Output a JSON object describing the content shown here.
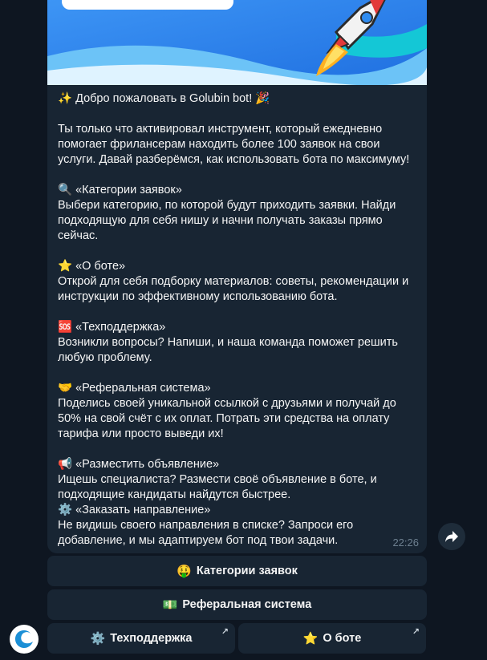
{
  "message": {
    "lines": [
      "✨ Добро пожаловать в Golubin bot! 🎉",
      "",
      "Ты только что активировал инструмент, который ежедневно",
      "помогает фрилансерам находить более 100 заявок на свои",
      "услуги. Давай разберёмся, как использовать бота по максимуму!",
      "",
      "🔍 «Категории заявок»",
      "Выбери категорию, по которой будут приходить заявки. Найди",
      "подходящую для себя нишу и начни получать заказы прямо",
      "сейчас.",
      "",
      "⭐ «О боте»",
      "Открой для себя подборку материалов: советы, рекомендации и",
      "инструкции по эффективному использованию бота.",
      "",
      "🆘 «Техподдержка»",
      "Возникли вопросы? Напиши, и наша команда поможет решить",
      "любую проблему.",
      "",
      "🤝 «Реферальная система»",
      "Поделись своей уникальной ссылкой с друзьями и получай до",
      "50% на свой счёт с их оплат. Потрать эти средства на оплату",
      "тарифа или просто выведи их!",
      "",
      "📢 «Разместить объявление»",
      "Ищешь специалиста? Размести своё объявление в боте, и",
      "подходящие кандидаты найдутся быстрее.",
      "⚙️ «Заказать направление»",
      "Не видишь своего направления в списке? Запроси его",
      "добавление, и мы адаптируем бот под твои задачи."
    ],
    "time": "22:26"
  },
  "keyboard": {
    "categories": {
      "emoji": "🤑",
      "label": "Категории заявок"
    },
    "referral": {
      "emoji": "💵",
      "label": "Реферальная система"
    },
    "support": {
      "emoji": "⚙️",
      "label": "Техподдержка",
      "arrow": "↗"
    },
    "about": {
      "emoji": "⭐",
      "label": "О боте",
      "arrow": "↗"
    }
  },
  "icons": {
    "share": "share-icon",
    "avatar": "bot-avatar-icon"
  },
  "colors": {
    "background": "#0e1621",
    "bubble": "#182533",
    "text": "#f5f5f5",
    "time": "#6d7f8f"
  }
}
